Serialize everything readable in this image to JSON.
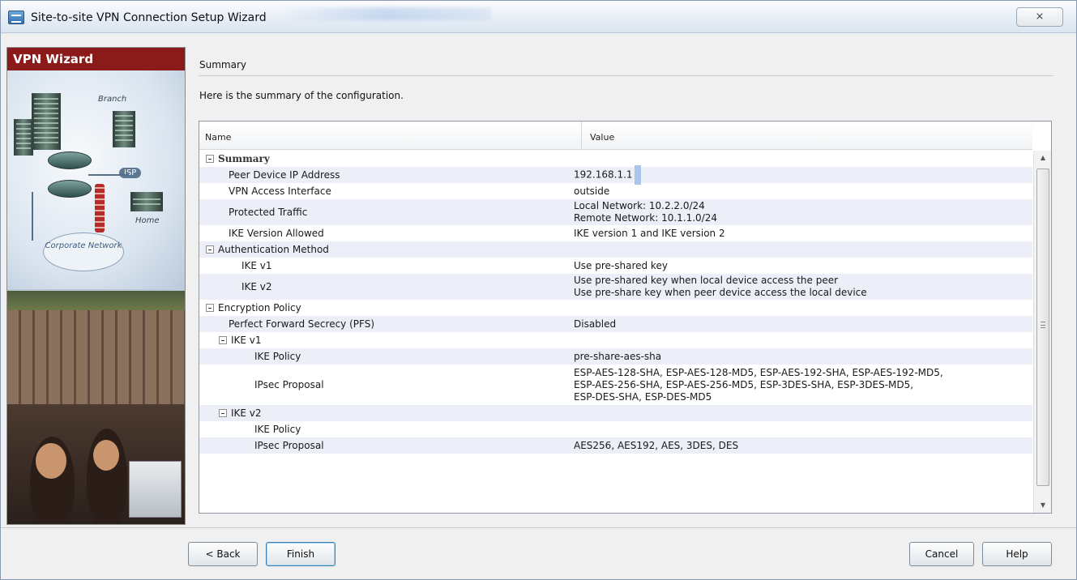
{
  "window": {
    "title": "Site-to-site VPN Connection Setup Wizard",
    "close_label": "⨯"
  },
  "banner": {
    "heading": "VPN Wizard",
    "labels": {
      "branch": "Branch",
      "isp": "ISP",
      "home": "Home",
      "corporate": "Corporate Network"
    }
  },
  "page": {
    "section_title": "Summary",
    "subtitle": "Here is the summary of the configuration."
  },
  "table": {
    "columns": {
      "name": "Name",
      "value": "Value"
    },
    "rows": [
      {
        "name": "Summary",
        "level": 0,
        "group": true,
        "bold": true,
        "value": []
      },
      {
        "name": "Peer Device IP Address",
        "level": 1,
        "value": [
          "192.168.1.1"
        ],
        "cursor": true
      },
      {
        "name": "VPN Access Interface",
        "level": 1,
        "value": [
          "outside"
        ]
      },
      {
        "name": "Protected Traffic",
        "level": 1,
        "value": [
          "Local Network: 10.2.2.0/24",
          "Remote Network: 10.1.1.0/24"
        ]
      },
      {
        "name": "IKE Version Allowed",
        "level": 1,
        "value": [
          "IKE version 1 and IKE version 2"
        ]
      },
      {
        "name": "Authentication Method",
        "level": 0,
        "group": true,
        "value": []
      },
      {
        "name": "IKE v1",
        "level": 2,
        "value": [
          "Use pre-shared key"
        ]
      },
      {
        "name": "IKE v2",
        "level": 2,
        "value": [
          "Use pre-shared key when local device access the peer",
          "Use pre-share key when peer device access the local device"
        ]
      },
      {
        "name": "Encryption Policy",
        "level": 0,
        "group": true,
        "value": []
      },
      {
        "name": "Perfect Forward Secrecy (PFS)",
        "level": 1,
        "value": [
          "Disabled"
        ]
      },
      {
        "name": "IKE v1",
        "level": 1,
        "group": true,
        "value": []
      },
      {
        "name": "IKE Policy",
        "level": 3,
        "value": [
          "pre-share-aes-sha"
        ]
      },
      {
        "name": "IPsec Proposal",
        "level": 3,
        "value": [
          "ESP-AES-128-SHA, ESP-AES-128-MD5, ESP-AES-192-SHA, ESP-AES-192-MD5,",
          "ESP-AES-256-SHA, ESP-AES-256-MD5, ESP-3DES-SHA, ESP-3DES-MD5,",
          "ESP-DES-SHA, ESP-DES-MD5"
        ]
      },
      {
        "name": "IKE v2",
        "level": 1,
        "group": true,
        "value": []
      },
      {
        "name": "IKE Policy",
        "level": 3,
        "value": []
      },
      {
        "name": "IPsec Proposal",
        "level": 3,
        "value": [
          "AES256, AES192, AES, 3DES, DES"
        ]
      }
    ]
  },
  "buttons": {
    "back": "< Back",
    "finish": "Finish",
    "cancel": "Cancel",
    "help": "Help"
  },
  "colors": {
    "banner_red": "#8b1a1a",
    "row_alt": "#eceef8",
    "primary_border": "#3c7fb1"
  }
}
